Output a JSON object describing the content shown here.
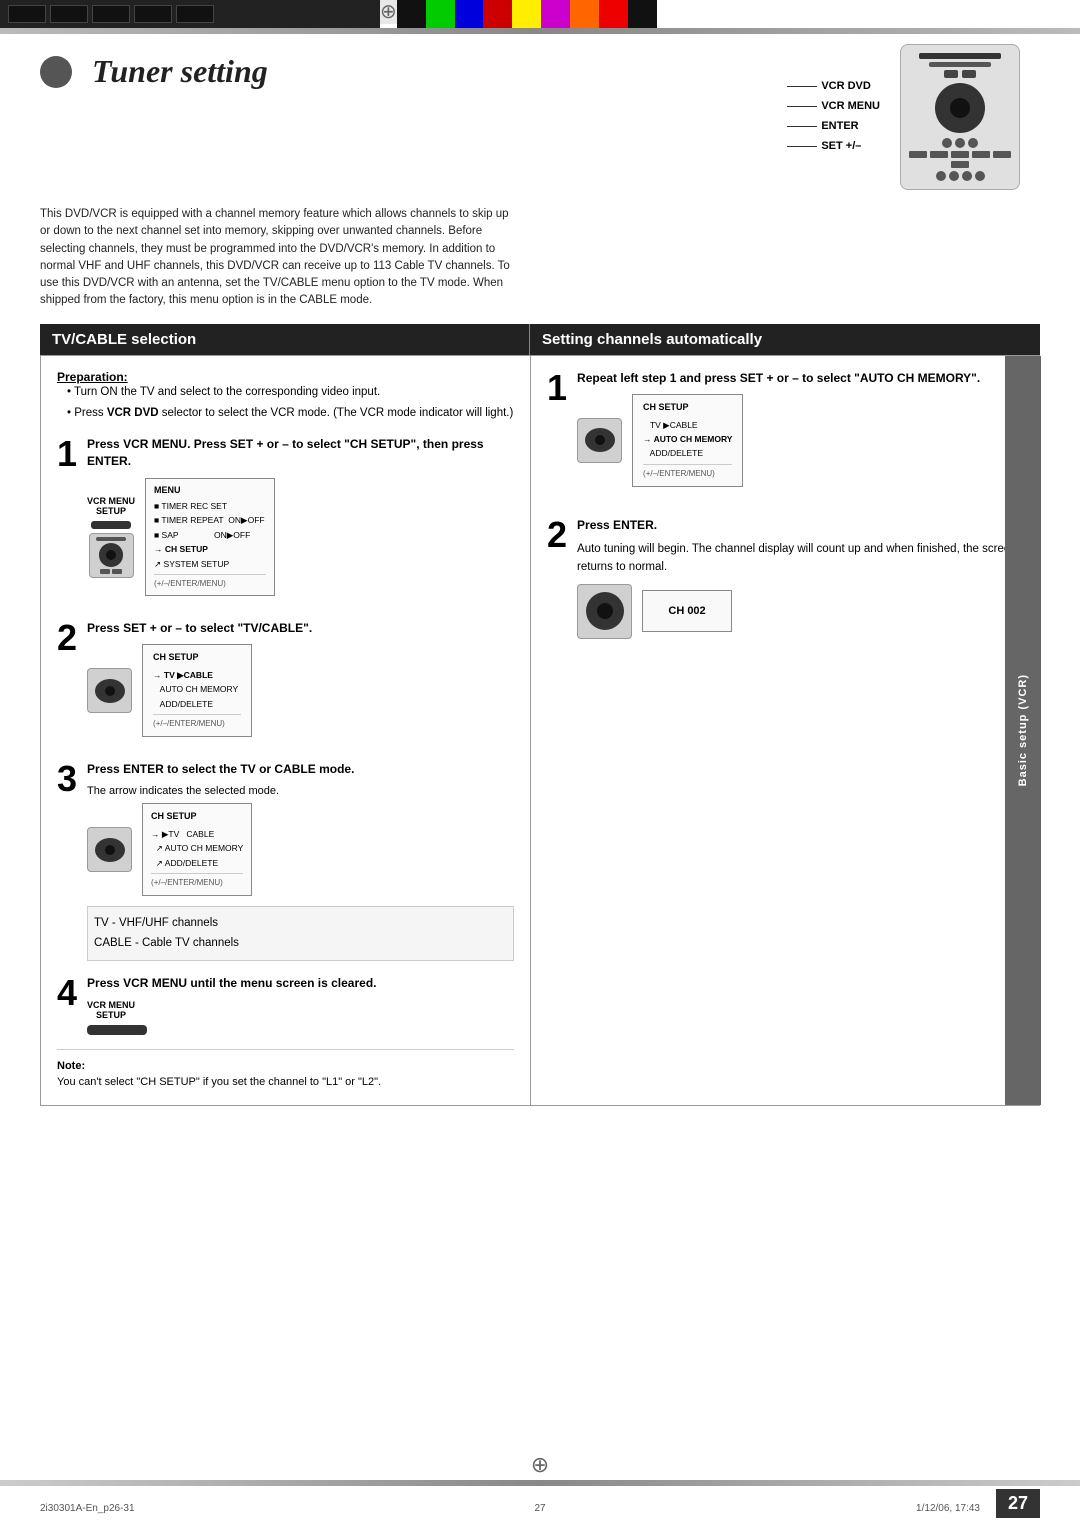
{
  "page": {
    "number": "27",
    "file_left": "2i30301A-En_p26-31",
    "file_center": "27",
    "file_right": "1/12/06, 17:43"
  },
  "header": {
    "title": "Tuner setting",
    "description": "This DVD/VCR is equipped with a channel memory feature which allows channels to skip up or down to the next channel set into memory, skipping over unwanted channels. Before selecting channels, they must be programmed into the DVD/VCR's memory. In addition to normal VHF and UHF channels, this DVD/VCR can receive up to 113 Cable TV channels. To use this DVD/VCR with an antenna, set the TV/CABLE menu option to the TV mode. When shipped from the factory, this menu option is in the CABLE mode."
  },
  "remote_labels": {
    "vcr_dvd": "VCR DVD",
    "vcr_menu": "VCR MENU",
    "enter": "ENTER",
    "set_pm": "SET +/–"
  },
  "tv_cable": {
    "title": "TV/CABLE selection",
    "preparation_title": "Preparation:",
    "prep_items": [
      "Turn ON the TV and select to the corresponding video input.",
      "Press VCR DVD selector to select the VCR mode. (The VCR mode indicator will light.)"
    ],
    "step1": {
      "number": "1",
      "text": "Press VCR MENU. Press SET + or – to select \"CH SETUP\", then press ENTER.",
      "vcr_menu_label": "VCR MENU",
      "setup_label": "SETUP"
    },
    "step2": {
      "number": "2",
      "text": "Press SET + or – to select \"TV/CABLE\".",
      "ch_setup_title": "CH SETUP",
      "screen_items": [
        "  TV ▶CABLE",
        "↗ AUTO CH MEMORY",
        "↗ ADD/DELETE"
      ],
      "screen_footer": "(+/–/ENTER/MENU)"
    },
    "step3": {
      "number": "3",
      "text": "Press ENTER to select the TV or CABLE mode.",
      "note": "The arrow indicates the selected mode.",
      "ch_setup_title": "CH SETUP",
      "screen_items": [
        "↗ TV  ▶TV CABLE",
        "↗ AUTO CH MEMORY",
        "↗ ADD/DELETE"
      ],
      "screen_footer": "(+/–/ENTER/MENU)",
      "channels_tv": "TV      - VHF/UHF channels",
      "channels_cable": "CABLE  - Cable TV channels"
    },
    "step4": {
      "number": "4",
      "text": "Press VCR MENU until the menu screen is cleared.",
      "vcr_menu_label": "VCR MENU",
      "setup_label": "SETUP"
    },
    "note_title": "Note:",
    "note_text": "You can't select \"CH SETUP\" if you set the channel to \"L1\" or \"L2\"."
  },
  "setting_channels": {
    "title": "Setting channels automatically",
    "step1": {
      "number": "1",
      "text": "Repeat left step 1 and press SET + or – to select \"AUTO CH MEMORY\".",
      "ch_setup_title": "CH SETUP",
      "screen_items": [
        "  TV ▶CABLE",
        "→ AUTO CH MEMORY",
        "  ADD/DELETE"
      ],
      "screen_footer": "(+/–/ENTER/MENU)"
    },
    "step2": {
      "number": "2",
      "text": "Press ENTER.",
      "auto_text": "Auto tuning will begin. The channel display will count up and when finished, the screen returns to normal.",
      "screen_label": "CH 002"
    }
  },
  "sidebar_label": "Basic setup (VCR)",
  "menu_screen": {
    "title": "MENU",
    "items": [
      "■ TIMER REC SET",
      "■ TIMER REPEAT  ON ▶OFF",
      "■ SAP              ON ▶OFF",
      "→ CH SETUP",
      "↗ SYSTEM SETUP"
    ],
    "footer": "(+/–/ENTER/MENU)"
  },
  "colors": {
    "header_bg": "#222222",
    "header_text": "#ffffff",
    "accent": "#555555",
    "border": "#999999",
    "screen_bg": "#fafafa",
    "page_num_bg": "#333333",
    "page_num_text": "#ffffff"
  },
  "color_blocks_right": [
    "#111",
    "#00aa00",
    "#0000cc",
    "#cc0000",
    "#cccc00",
    "#cc00cc",
    "#ff8800",
    "#ee0000",
    "#222"
  ]
}
